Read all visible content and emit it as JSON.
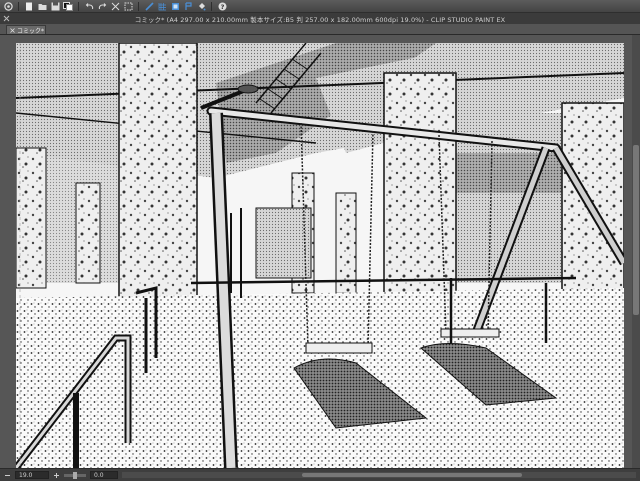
{
  "window": {
    "title": "コミック* (A4 297.00 x 210.00mm 製本サイズ:B5 判 257.00 x 182.00mm 600dpi 19.0%) - CLIP STUDIO PAINT EX"
  },
  "tabs": [
    {
      "label": "コミック*"
    }
  ],
  "toolbar": {
    "icons": [
      "clip-logo-icon",
      "new-icon",
      "open-icon",
      "save-icon",
      "color-swatch-icon",
      "undo-icon",
      "redo-icon",
      "clear-icon",
      "transform-icon",
      "snap-ruler-icon",
      "snap-grid-icon",
      "layer-icon",
      "fill-icon",
      "bucket-icon",
      "help-icon"
    ]
  },
  "status": {
    "zoom": "19.0",
    "angle": "0.0"
  },
  "colors": {
    "chrome_dark": "#3b3b3b",
    "chrome_mid": "#555555",
    "canvas_bg": "#f4f4f4",
    "accent_blue": "#4a8fd6"
  }
}
